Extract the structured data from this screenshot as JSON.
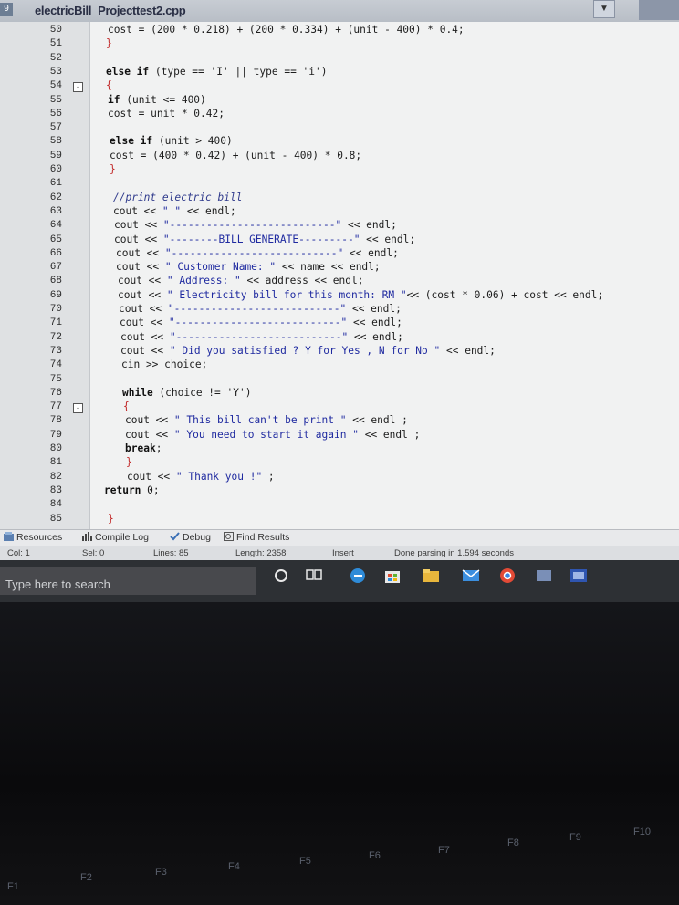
{
  "window": {
    "app_icon_text": "9",
    "file_tab": "electricBill_Projecttest2.cpp"
  },
  "editor": {
    "line_numbers": [
      "50",
      "51",
      "52",
      "53",
      "54",
      "55",
      "56",
      "57",
      "58",
      "59",
      "60",
      "61",
      "62",
      "63",
      "64",
      "65",
      "66",
      "67",
      "68",
      "69",
      "70",
      "71",
      "72",
      "73",
      "74",
      "75",
      "76",
      "77",
      "78",
      "79",
      "80",
      "81",
      "82",
      "83",
      "84",
      "85"
    ],
    "lines": [
      "cost = (200 * 0.218) + (200 * 0.334) + (unit - 400) * 0.4;",
      "}",
      "",
      "else if (type == 'I' || type == 'i')",
      "{",
      "if (unit <= 400)",
      "cost = unit * 0.42;",
      "",
      "else if (unit > 400)",
      "cost = (400 * 0.42) + (unit - 400) * 0.8;",
      "}",
      "",
      "//print electric bill",
      "cout << \" \" << endl;",
      "cout << \"---------------------------\" << endl;",
      "cout << \"--------BILL GENERATE---------\" << endl;",
      "cout << \"---------------------------\" << endl;",
      "cout << \" Customer Name: \" << name << endl;",
      "cout << \" Address: \" << address << endl;",
      "cout << \" Electricity bill for this month: RM \"<< (cost * 0.06) + cost << endl;",
      "cout << \"---------------------------\" << endl;",
      "cout << \"---------------------------\" << endl;",
      "cout << \"---------------------------\" << endl;",
      "cout << \" Did you satisfied ? Y for Yes , N for No \" << endl;",
      "cin >> choice;",
      "",
      "while (choice != 'Y')",
      "{",
      "cout << \" This bill can't be print \" << endl ;",
      "cout << \" You need to start it again \" << endl ;",
      "break;",
      "}",
      "cout << \" Thank you !\" ;",
      "return 0;",
      "",
      "}"
    ]
  },
  "bottom_tabs": [
    "Resources",
    "Compile Log",
    "Debug",
    "Find Results"
  ],
  "status": {
    "col": "Col: 1",
    "sel": "Sel: 0",
    "lines": "Lines: 85",
    "length": "Length: 2358",
    "mode": "Insert",
    "message": "Done parsing in 1.594 seconds"
  },
  "taskbar": {
    "search_placeholder": "Type here to search",
    "icons": [
      "cortana-icon",
      "task-view-icon",
      "edge-icon",
      "store-icon",
      "file-explorer-icon",
      "mail-icon",
      "chrome-icon",
      "app-icon",
      "devcpp-icon"
    ]
  },
  "keyboard": {
    "fkeys": [
      "F1",
      "F2",
      "F3",
      "F4",
      "F5",
      "F6",
      "F7",
      "F8",
      "F9",
      "F10"
    ]
  },
  "colors": {
    "editor_bg": "#f1f2f2",
    "gutter_bg": "#dfe1e3",
    "taskbar_bg": "#2d3034",
    "bracket": "#c22b2b"
  }
}
